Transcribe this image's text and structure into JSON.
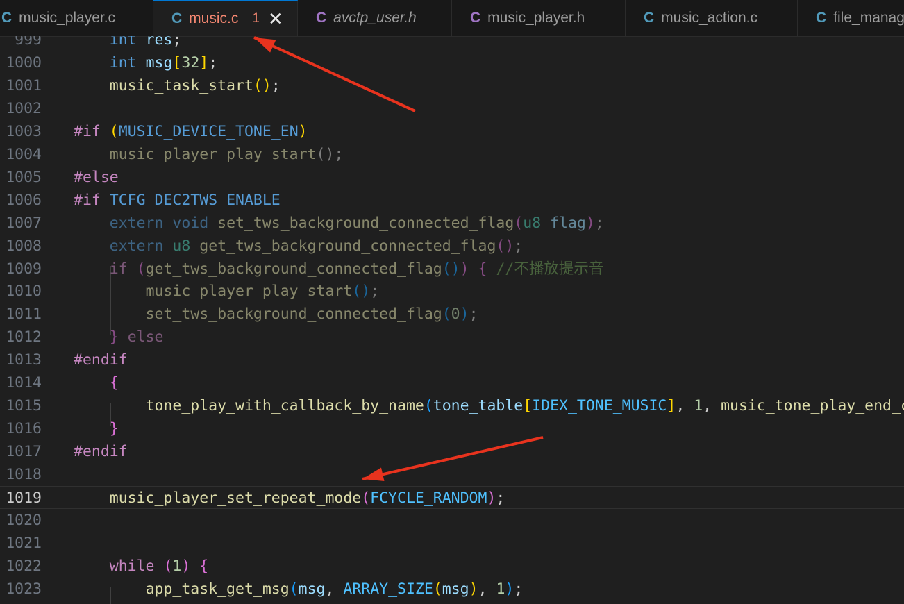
{
  "tabs": [
    {
      "name": "music_player.c",
      "icon": "C",
      "icon_color": "#519aba",
      "italic": false,
      "active": false
    },
    {
      "name": "music.c",
      "icon": "C",
      "icon_color": "#519aba",
      "italic": false,
      "active": true,
      "badge": "1",
      "close": "✕"
    },
    {
      "name": "avctp_user.h",
      "icon": "C",
      "icon_color": "#a074c4",
      "italic": true,
      "active": false
    },
    {
      "name": "music_player.h",
      "icon": "C",
      "icon_color": "#a074c4",
      "italic": false,
      "active": false
    },
    {
      "name": "music_action.c",
      "icon": "C",
      "icon_color": "#519aba",
      "italic": false,
      "active": false
    },
    {
      "name": "file_manag",
      "icon": "C",
      "icon_color": "#519aba",
      "italic": false,
      "active": false
    }
  ],
  "current_line": "1019",
  "lines": [
    {
      "n": "999",
      "tokens": [
        [
          "    ",
          ""
        ],
        [
          "int",
          "t-kw"
        ],
        [
          " ",
          ""
        ],
        [
          "res",
          "t-var"
        ],
        [
          ";",
          ""
        ]
      ]
    },
    {
      "n": "1000",
      "tokens": [
        [
          "    ",
          ""
        ],
        [
          "int",
          "t-kw"
        ],
        [
          " ",
          ""
        ],
        [
          "msg",
          "t-var"
        ],
        [
          "[",
          "t-br1"
        ],
        [
          "32",
          "t-num"
        ],
        [
          "]",
          "t-br1"
        ],
        [
          ";",
          ""
        ]
      ]
    },
    {
      "n": "1001",
      "tokens": [
        [
          "    ",
          ""
        ],
        [
          "music_task_start",
          "t-fn"
        ],
        [
          "()",
          "t-br1"
        ],
        [
          ";",
          ""
        ]
      ]
    },
    {
      "n": "1002",
      "tokens": []
    },
    {
      "n": "1003",
      "tokens": [
        [
          "#if",
          "t-ctl"
        ],
        [
          " ",
          ""
        ],
        [
          "(",
          "t-br1"
        ],
        [
          "MUSIC_DEVICE_TONE_EN",
          "t-kw"
        ],
        [
          ")",
          "t-br1"
        ]
      ]
    },
    {
      "n": "1004",
      "tokens": [
        [
          "    ",
          ""
        ],
        [
          "music_player_play_start",
          "t-fn"
        ],
        [
          "();",
          ""
        ]
      ],
      "dim": true
    },
    {
      "n": "1005",
      "tokens": [
        [
          "#else",
          "t-ctl"
        ]
      ]
    },
    {
      "n": "1006",
      "tokens": [
        [
          "#if",
          "t-ctl"
        ],
        [
          " ",
          ""
        ],
        [
          "TCFG_DEC2TWS_ENABLE",
          "t-kw"
        ]
      ]
    },
    {
      "n": "1007",
      "tokens": [
        [
          "    ",
          ""
        ],
        [
          "extern",
          "t-kw"
        ],
        [
          " ",
          ""
        ],
        [
          "void",
          "t-kw"
        ],
        [
          " ",
          ""
        ],
        [
          "set_tws_background_connected_flag",
          "t-fn"
        ],
        [
          "(",
          "t-br2"
        ],
        [
          "u8",
          "t-type"
        ],
        [
          " ",
          ""
        ],
        [
          "flag",
          "t-var"
        ],
        [
          ")",
          "t-br2"
        ],
        [
          ";",
          ""
        ]
      ],
      "dim": true
    },
    {
      "n": "1008",
      "tokens": [
        [
          "    ",
          ""
        ],
        [
          "extern",
          "t-kw"
        ],
        [
          " ",
          ""
        ],
        [
          "u8",
          "t-type"
        ],
        [
          " ",
          ""
        ],
        [
          "get_tws_background_connected_flag",
          "t-fn"
        ],
        [
          "()",
          "t-br2"
        ],
        [
          ";",
          ""
        ]
      ],
      "dim": true
    },
    {
      "n": "1009",
      "tokens": [
        [
          "    ",
          ""
        ],
        [
          "if",
          "t-ctl"
        ],
        [
          " ",
          ""
        ],
        [
          "(",
          "t-br2"
        ],
        [
          "get_tws_background_connected_flag",
          "t-fn"
        ],
        [
          "()",
          "t-br3"
        ],
        [
          ")",
          "t-br2"
        ],
        [
          " ",
          ""
        ],
        [
          "{",
          "t-br2"
        ],
        [
          " ",
          ""
        ],
        [
          "//不播放提示音",
          "t-cmt"
        ]
      ],
      "dim": true
    },
    {
      "n": "1010",
      "tokens": [
        [
          "        ",
          ""
        ],
        [
          "music_player_play_start",
          "t-fn"
        ],
        [
          "()",
          "t-br3"
        ],
        [
          ";",
          ""
        ]
      ],
      "dim": true
    },
    {
      "n": "1011",
      "tokens": [
        [
          "        ",
          ""
        ],
        [
          "set_tws_background_connected_flag",
          "t-fn"
        ],
        [
          "(",
          "t-br3"
        ],
        [
          "0",
          "t-num"
        ],
        [
          ")",
          "t-br3"
        ],
        [
          ";",
          ""
        ]
      ],
      "dim": true
    },
    {
      "n": "1012",
      "tokens": [
        [
          "    ",
          ""
        ],
        [
          "}",
          "t-br2"
        ],
        [
          " ",
          ""
        ],
        [
          "else",
          "t-ctl"
        ]
      ],
      "dim": true
    },
    {
      "n": "1013",
      "tokens": [
        [
          "#endif",
          "t-ctl"
        ]
      ]
    },
    {
      "n": "1014",
      "tokens": [
        [
          "    ",
          ""
        ],
        [
          "{",
          "t-br2"
        ]
      ]
    },
    {
      "n": "1015",
      "tokens": [
        [
          "        ",
          ""
        ],
        [
          "tone_play_with_callback_by_name",
          "t-fn"
        ],
        [
          "(",
          "t-br3"
        ],
        [
          "tone_table",
          "t-var"
        ],
        [
          "[",
          "t-br1"
        ],
        [
          "IDEX_TONE_MUSIC",
          "t-macro"
        ],
        [
          "]",
          "t-br1"
        ],
        [
          ", ",
          ""
        ],
        [
          "1",
          "t-num"
        ],
        [
          ", ",
          ""
        ],
        [
          "music_tone_play_end_callback",
          "t-fn"
        ]
      ]
    },
    {
      "n": "1016",
      "tokens": [
        [
          "    ",
          ""
        ],
        [
          "}",
          "t-br2"
        ]
      ]
    },
    {
      "n": "1017",
      "tokens": [
        [
          "#endif",
          "t-ctl"
        ]
      ]
    },
    {
      "n": "1018",
      "tokens": []
    },
    {
      "n": "1019",
      "tokens": [
        [
          "    ",
          ""
        ],
        [
          "music_player_set_repeat_mode",
          "t-fn"
        ],
        [
          "(",
          "t-br2"
        ],
        [
          "FCYCLE_RANDOM",
          "t-macro"
        ],
        [
          ")",
          "t-br2"
        ],
        [
          ";",
          ""
        ]
      ]
    },
    {
      "n": "1020",
      "tokens": []
    },
    {
      "n": "1021",
      "tokens": []
    },
    {
      "n": "1022",
      "tokens": [
        [
          "    ",
          ""
        ],
        [
          "while",
          "t-ctl"
        ],
        [
          " ",
          ""
        ],
        [
          "(",
          "t-br2"
        ],
        [
          "1",
          "t-num"
        ],
        [
          ")",
          "t-br2"
        ],
        [
          " ",
          ""
        ],
        [
          "{",
          "t-br2"
        ]
      ]
    },
    {
      "n": "1023",
      "tokens": [
        [
          "        ",
          ""
        ],
        [
          "app_task_get_msg",
          "t-fn"
        ],
        [
          "(",
          "t-br3"
        ],
        [
          "msg",
          "t-var"
        ],
        [
          ", ",
          ""
        ],
        [
          "ARRAY_SIZE",
          "t-macro"
        ],
        [
          "(",
          "t-br1"
        ],
        [
          "msg",
          "t-var"
        ],
        [
          ")",
          "t-br1"
        ],
        [
          ", ",
          ""
        ],
        [
          "1",
          "t-num"
        ],
        [
          ")",
          "t-br3"
        ],
        [
          ";",
          ""
        ]
      ]
    }
  ],
  "annotation_color": "#e8331e"
}
